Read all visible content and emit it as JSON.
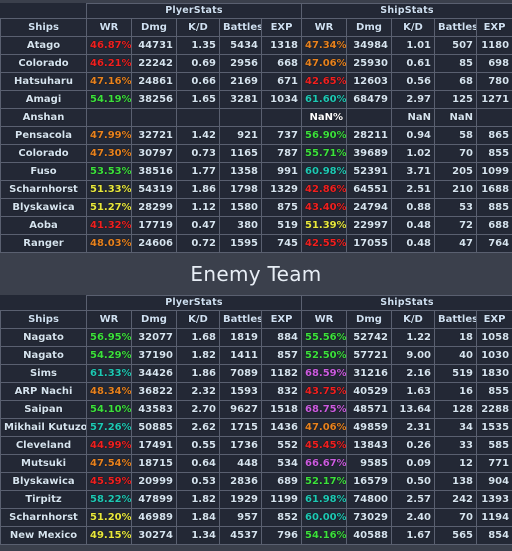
{
  "banner": {
    "enemy_title": "Enemy Team"
  },
  "colors": {
    "background": "#3b404c",
    "table_background": "#232835",
    "grid_line": "#5a6070",
    "text": "#d6e4f0",
    "wr_red": "#f02020",
    "wr_orange": "#e8821e",
    "wr_yellow": "#e8e83c",
    "wr_green": "#3ce03c",
    "wr_teal": "#1ec8b4",
    "wr_purple": "#cc5ce0",
    "wr_white": "#ffffff"
  },
  "columns": {
    "group_player": "PlyerStats",
    "group_ship": "ShipStats",
    "ships": "Ships",
    "wr": "WR",
    "dmg": "Dmg",
    "kd": "K/D",
    "battles": "Battles",
    "exp": "EXP"
  },
  "ally_team": {
    "rows": [
      {
        "ship": "Atago",
        "p_wr": "46.87%",
        "p_wr_color": "#f02020",
        "p_dmg": "44731",
        "p_kd": "1.35",
        "p_battles": "5434",
        "p_exp": "1318",
        "s_wr": "47.34%",
        "s_wr_color": "#e8821e",
        "s_dmg": "34984",
        "s_kd": "1.01",
        "s_battles": "507",
        "s_exp": "1180"
      },
      {
        "ship": "Colorado",
        "p_wr": "46.21%",
        "p_wr_color": "#f02020",
        "p_dmg": "22242",
        "p_kd": "0.69",
        "p_battles": "2956",
        "p_exp": "668",
        "s_wr": "47.06%",
        "s_wr_color": "#e8821e",
        "s_dmg": "25930",
        "s_kd": "0.61",
        "s_battles": "85",
        "s_exp": "698"
      },
      {
        "ship": "Hatsuharu",
        "p_wr": "47.16%",
        "p_wr_color": "#e8821e",
        "p_dmg": "24861",
        "p_kd": "0.66",
        "p_battles": "2169",
        "p_exp": "671",
        "s_wr": "42.65%",
        "s_wr_color": "#f02020",
        "s_dmg": "12603",
        "s_kd": "0.56",
        "s_battles": "68",
        "s_exp": "780"
      },
      {
        "ship": "Amagi",
        "p_wr": "54.19%",
        "p_wr_color": "#3ce03c",
        "p_dmg": "38256",
        "p_kd": "1.65",
        "p_battles": "3281",
        "p_exp": "1034",
        "s_wr": "61.60%",
        "s_wr_color": "#1ec8b4",
        "s_dmg": "68479",
        "s_kd": "2.97",
        "s_battles": "125",
        "s_exp": "1271"
      },
      {
        "ship": "Anshan",
        "p_wr": "",
        "p_wr_color": "#ffffff",
        "p_dmg": "",
        "p_kd": "",
        "p_battles": "",
        "p_exp": "",
        "s_wr": "NaN%",
        "s_wr_color": "#ffffff",
        "s_dmg": "",
        "s_kd": "NaN",
        "s_battles": "NaN",
        "s_exp": ""
      },
      {
        "ship": "Pensacola",
        "p_wr": "47.99%",
        "p_wr_color": "#e8821e",
        "p_dmg": "32721",
        "p_kd": "1.42",
        "p_battles": "921",
        "p_exp": "737",
        "s_wr": "56.90%",
        "s_wr_color": "#3ce03c",
        "s_dmg": "28211",
        "s_kd": "0.94",
        "s_battles": "58",
        "s_exp": "865"
      },
      {
        "ship": "Colorado",
        "p_wr": "47.30%",
        "p_wr_color": "#e8821e",
        "p_dmg": "30797",
        "p_kd": "0.73",
        "p_battles": "1165",
        "p_exp": "787",
        "s_wr": "55.71%",
        "s_wr_color": "#3ce03c",
        "s_dmg": "39689",
        "s_kd": "1.02",
        "s_battles": "70",
        "s_exp": "855"
      },
      {
        "ship": "Fuso",
        "p_wr": "53.53%",
        "p_wr_color": "#3ce03c",
        "p_dmg": "38516",
        "p_kd": "1.77",
        "p_battles": "1358",
        "p_exp": "991",
        "s_wr": "60.98%",
        "s_wr_color": "#1ec8b4",
        "s_dmg": "52391",
        "s_kd": "3.71",
        "s_battles": "205",
        "s_exp": "1099"
      },
      {
        "ship": "Scharnhorst",
        "p_wr": "51.33%",
        "p_wr_color": "#e8e83c",
        "p_dmg": "54319",
        "p_kd": "1.86",
        "p_battles": "1798",
        "p_exp": "1329",
        "s_wr": "42.86%",
        "s_wr_color": "#f02020",
        "s_dmg": "64551",
        "s_kd": "2.51",
        "s_battles": "210",
        "s_exp": "1688"
      },
      {
        "ship": "Blyskawica",
        "p_wr": "51.27%",
        "p_wr_color": "#e8e83c",
        "p_dmg": "28299",
        "p_kd": "1.12",
        "p_battles": "1580",
        "p_exp": "875",
        "s_wr": "43.40%",
        "s_wr_color": "#f02020",
        "s_dmg": "24794",
        "s_kd": "0.88",
        "s_battles": "53",
        "s_exp": "885"
      },
      {
        "ship": "Aoba",
        "p_wr": "41.32%",
        "p_wr_color": "#f02020",
        "p_dmg": "17719",
        "p_kd": "0.47",
        "p_battles": "380",
        "p_exp": "519",
        "s_wr": "51.39%",
        "s_wr_color": "#e8e83c",
        "s_dmg": "22997",
        "s_kd": "0.48",
        "s_battles": "72",
        "s_exp": "688"
      },
      {
        "ship": "Ranger",
        "p_wr": "48.03%",
        "p_wr_color": "#e8821e",
        "p_dmg": "24606",
        "p_kd": "0.72",
        "p_battles": "1595",
        "p_exp": "745",
        "s_wr": "42.55%",
        "s_wr_color": "#f02020",
        "s_dmg": "17055",
        "s_kd": "0.48",
        "s_battles": "47",
        "s_exp": "764"
      }
    ]
  },
  "enemy_team": {
    "rows": [
      {
        "ship": "Nagato",
        "p_wr": "56.95%",
        "p_wr_color": "#3ce03c",
        "p_dmg": "32077",
        "p_kd": "1.68",
        "p_battles": "1819",
        "p_exp": "884",
        "s_wr": "55.56%",
        "s_wr_color": "#3ce03c",
        "s_dmg": "52742",
        "s_kd": "1.22",
        "s_battles": "18",
        "s_exp": "1058"
      },
      {
        "ship": "Nagato",
        "p_wr": "54.29%",
        "p_wr_color": "#3ce03c",
        "p_dmg": "37190",
        "p_kd": "1.82",
        "p_battles": "1411",
        "p_exp": "857",
        "s_wr": "52.50%",
        "s_wr_color": "#3ce03c",
        "s_dmg": "57721",
        "s_kd": "9.00",
        "s_battles": "40",
        "s_exp": "1030"
      },
      {
        "ship": "Sims",
        "p_wr": "61.33%",
        "p_wr_color": "#1ec8b4",
        "p_dmg": "34426",
        "p_kd": "1.86",
        "p_battles": "7089",
        "p_exp": "1182",
        "s_wr": "68.59%",
        "s_wr_color": "#cc5ce0",
        "s_dmg": "31216",
        "s_kd": "2.16",
        "s_battles": "519",
        "s_exp": "1830"
      },
      {
        "ship": "ARP Nachi",
        "p_wr": "48.34%",
        "p_wr_color": "#e8821e",
        "p_dmg": "36822",
        "p_kd": "2.32",
        "p_battles": "1593",
        "p_exp": "832",
        "s_wr": "43.75%",
        "s_wr_color": "#f02020",
        "s_dmg": "40529",
        "s_kd": "1.63",
        "s_battles": "16",
        "s_exp": "855"
      },
      {
        "ship": "Saipan",
        "p_wr": "54.10%",
        "p_wr_color": "#3ce03c",
        "p_dmg": "43583",
        "p_kd": "2.70",
        "p_battles": "9627",
        "p_exp": "1518",
        "s_wr": "68.75%",
        "s_wr_color": "#cc5ce0",
        "s_dmg": "48571",
        "s_kd": "13.64",
        "s_battles": "128",
        "s_exp": "2288"
      },
      {
        "ship": "Mikhail Kutuzov",
        "p_wr": "57.26%",
        "p_wr_color": "#1ec8b4",
        "p_dmg": "50885",
        "p_kd": "2.62",
        "p_battles": "1715",
        "p_exp": "1436",
        "s_wr": "47.06%",
        "s_wr_color": "#e8821e",
        "s_dmg": "49859",
        "s_kd": "2.31",
        "s_battles": "34",
        "s_exp": "1535"
      },
      {
        "ship": "Cleveland",
        "p_wr": "44.99%",
        "p_wr_color": "#f02020",
        "p_dmg": "17491",
        "p_kd": "0.55",
        "p_battles": "1736",
        "p_exp": "552",
        "s_wr": "45.45%",
        "s_wr_color": "#f02020",
        "s_dmg": "13843",
        "s_kd": "0.26",
        "s_battles": "33",
        "s_exp": "585"
      },
      {
        "ship": "Mutsuki",
        "p_wr": "47.54%",
        "p_wr_color": "#e8821e",
        "p_dmg": "18715",
        "p_kd": "0.64",
        "p_battles": "448",
        "p_exp": "534",
        "s_wr": "66.67%",
        "s_wr_color": "#cc5ce0",
        "s_dmg": "9585",
        "s_kd": "0.09",
        "s_battles": "12",
        "s_exp": "771"
      },
      {
        "ship": "Blyskawica",
        "p_wr": "45.59%",
        "p_wr_color": "#f02020",
        "p_dmg": "20999",
        "p_kd": "0.53",
        "p_battles": "2836",
        "p_exp": "689",
        "s_wr": "52.17%",
        "s_wr_color": "#3ce03c",
        "s_dmg": "16579",
        "s_kd": "0.50",
        "s_battles": "138",
        "s_exp": "904"
      },
      {
        "ship": "Tirpitz",
        "p_wr": "58.22%",
        "p_wr_color": "#1ec8b4",
        "p_dmg": "47899",
        "p_kd": "1.82",
        "p_battles": "1929",
        "p_exp": "1199",
        "s_wr": "61.98%",
        "s_wr_color": "#1ec8b4",
        "s_dmg": "74800",
        "s_kd": "2.57",
        "s_battles": "242",
        "s_exp": "1393"
      },
      {
        "ship": "Scharnhorst",
        "p_wr": "51.20%",
        "p_wr_color": "#e8e83c",
        "p_dmg": "46989",
        "p_kd": "1.84",
        "p_battles": "957",
        "p_exp": "852",
        "s_wr": "60.00%",
        "s_wr_color": "#1ec8b4",
        "s_dmg": "73029",
        "s_kd": "2.40",
        "s_battles": "70",
        "s_exp": "1194"
      },
      {
        "ship": "New Mexico",
        "p_wr": "49.15%",
        "p_wr_color": "#e8e83c",
        "p_dmg": "30274",
        "p_kd": "1.34",
        "p_battles": "4537",
        "p_exp": "796",
        "s_wr": "54.16%",
        "s_wr_color": "#3ce03c",
        "s_dmg": "40588",
        "s_kd": "1.67",
        "s_battles": "565",
        "s_exp": "854"
      }
    ]
  }
}
